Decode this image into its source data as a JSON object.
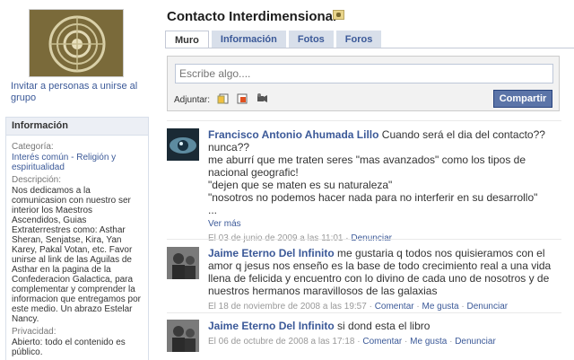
{
  "page": {
    "title": "Contacto Interdimensional"
  },
  "tabs": [
    {
      "label": "Muro",
      "active": true
    },
    {
      "label": "Información",
      "active": false
    },
    {
      "label": "Fotos",
      "active": false
    },
    {
      "label": "Foros",
      "active": false
    }
  ],
  "sidebar": {
    "invite_link": "Invitar a personas a unirse al grupo",
    "info_header": "Información",
    "category_label": "Categoría:",
    "category_value": "Interés común - Religión y espiritualidad",
    "description_label": "Descripción:",
    "description_value": "Nos dedicamos a la comunicasion con nuestro ser interior los Maestros Ascendidos, Guias Extraterrestres como: Asthar Sheran, Senjatse, Kira, Yan Karey, Pakal Votan, etc. Favor unirse al link de las Aguilas de Asthar en la pagina de la Confederacion Galactica, para complementar y comprender la informacion que entregamos por este medio. Un abrazo Estelar Nancy.",
    "privacy_label": "Privacidad:",
    "privacy_value": "Abierto: todo el contenido es público."
  },
  "composer": {
    "placeholder": "Escribe algo....",
    "attach_label": "Adjuntar:",
    "attach_icons": [
      "photo-icon",
      "link-icon",
      "video-icon"
    ],
    "share_button": "Compartir"
  },
  "feed": [
    {
      "author": "Francisco Antonio Ahumada Lillo",
      "lines": [
        "Cuando será el dia del contacto?? nunca??",
        "me aburrí que me traten seres \"mas avanzados\" como los tipos de nacional geografic!",
        "\"dejen que se maten es su naturaleza\"",
        "\"nosotros no podemos hacer nada para no interferir en su desarrollo\"",
        "..."
      ],
      "see_more": "Ver más",
      "timestamp": "El 03 de junio de 2009 a las 11:01",
      "actions": [
        "Denunciar"
      ]
    },
    {
      "author": "Jaime Eterno Del Infinito",
      "text": "me gustaria q todos nos quisieramos con el amor q jesus nos enseño es la base de todo crecimiento real a una vida llena de felicida y encuentro con lo divino de cada uno de nosotros y de nuestros hermanos maravillosos de las galaxias",
      "timestamp": "El 18 de noviembre de 2008 a las 19:57",
      "actions": [
        "Comentar",
        "Me gusta",
        "Denunciar"
      ]
    },
    {
      "author": "Jaime Eterno Del Infinito",
      "text": "si dond esta el libro",
      "timestamp": "El 06 de octubre de 2008 a las 17:18",
      "actions": [
        "Comentar",
        "Me gusta",
        "Denunciar"
      ]
    }
  ],
  "colors": {
    "link": "#3b5998",
    "tab_bg": "#d8dfea",
    "button_bg": "#5b74a8"
  }
}
